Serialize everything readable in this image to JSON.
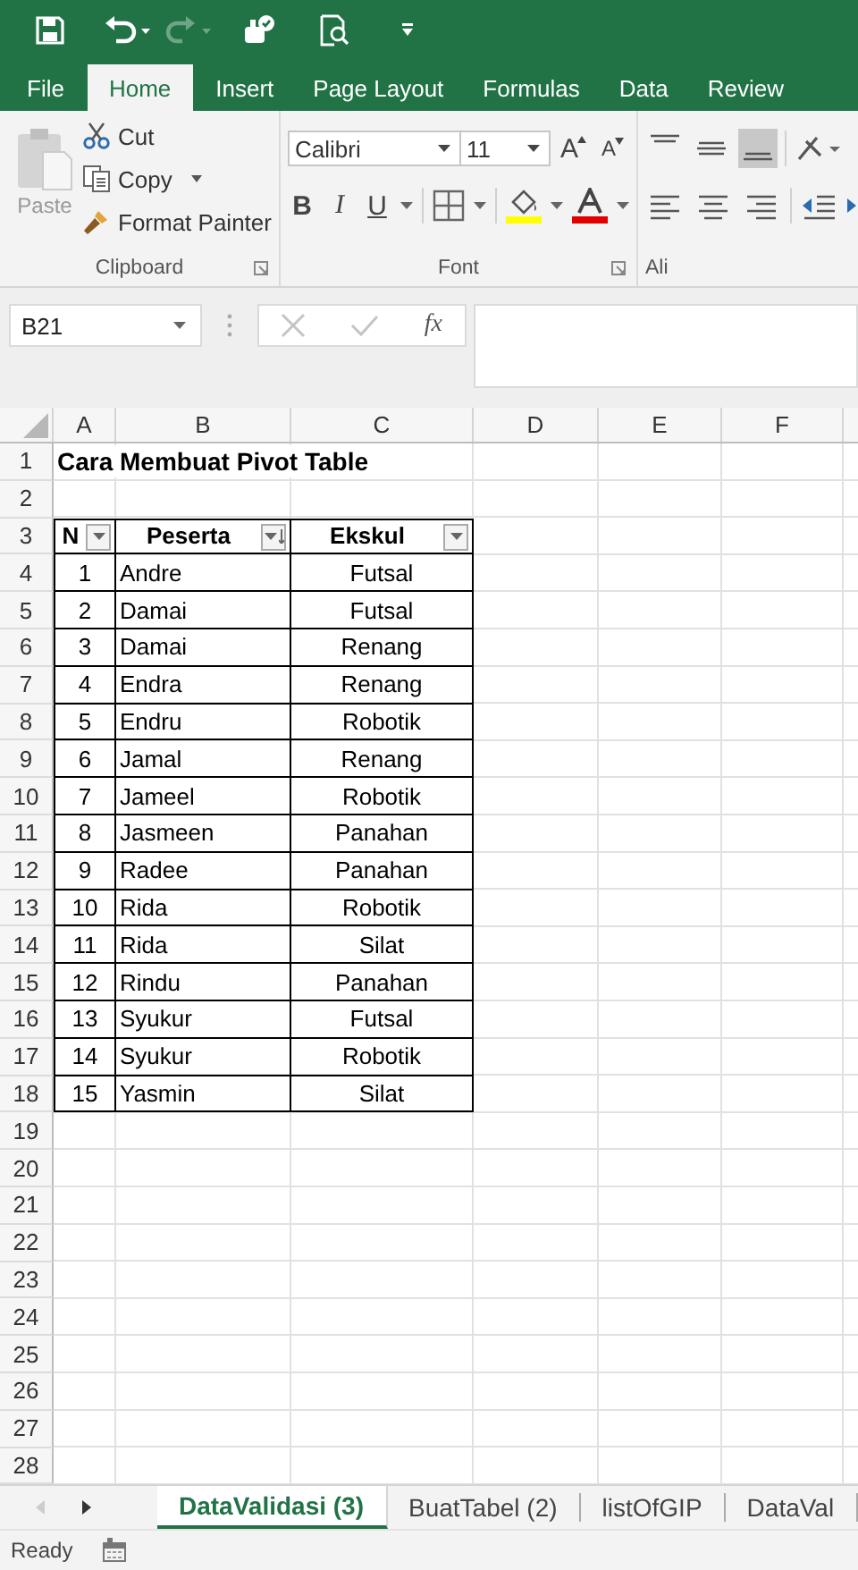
{
  "quick_access": {
    "redo_disabled": true
  },
  "ribbon_tabs": [
    {
      "label": "File",
      "selected": false
    },
    {
      "label": "Home",
      "selected": true
    },
    {
      "label": "Insert",
      "selected": false
    },
    {
      "label": "Page Layout",
      "selected": false
    },
    {
      "label": "Formulas",
      "selected": false
    },
    {
      "label": "Data",
      "selected": false
    },
    {
      "label": "Review",
      "selected": false
    }
  ],
  "clipboard": {
    "paste": "Paste",
    "paste_disabled": true,
    "cut": "Cut",
    "copy": "Copy",
    "format_painter": "Format Painter",
    "group_label": "Clipboard"
  },
  "font": {
    "name": "Calibri",
    "size": "11",
    "grow": "A",
    "shrink": "A",
    "bold": "B",
    "italic": "I",
    "underline": "U",
    "group_label": "Font"
  },
  "alignment": {
    "group_label": "Ali",
    "vertical": [
      {
        "kind": "top",
        "selected": false
      },
      {
        "kind": "middle",
        "selected": false
      },
      {
        "kind": "bottom",
        "selected": true
      }
    ]
  },
  "formula_bar": {
    "name_box": "B21",
    "function_label": "fx"
  },
  "sheet": {
    "columns": [
      "A",
      "B",
      "C",
      "D",
      "E",
      "F"
    ],
    "rows": [
      {
        "number": "1",
        "kind": "title",
        "text": "Cara Membuat Pivot Table"
      },
      {
        "number": "2",
        "kind": "blank"
      },
      {
        "number": "3",
        "kind": "header",
        "cells": [
          {
            "text": "N",
            "sorted": false
          },
          {
            "text": "Peserta",
            "sorted": true
          },
          {
            "text": "Ekskul",
            "sorted": false
          }
        ]
      },
      {
        "number": "4",
        "kind": "data",
        "cells": [
          "1",
          "Andre",
          "Futsal"
        ]
      },
      {
        "number": "5",
        "kind": "data",
        "cells": [
          "2",
          "Damai",
          "Futsal"
        ]
      },
      {
        "number": "6",
        "kind": "data",
        "cells": [
          "3",
          "Damai",
          "Renang"
        ]
      },
      {
        "number": "7",
        "kind": "data",
        "cells": [
          "4",
          "Endra",
          "Renang"
        ]
      },
      {
        "number": "8",
        "kind": "data",
        "cells": [
          "5",
          "Endru",
          "Robotik"
        ]
      },
      {
        "number": "9",
        "kind": "data",
        "cells": [
          "6",
          "Jamal",
          "Renang"
        ]
      },
      {
        "number": "10",
        "kind": "data",
        "cells": [
          "7",
          "Jameel",
          "Robotik"
        ]
      },
      {
        "number": "11",
        "kind": "data",
        "cells": [
          "8",
          "Jasmeen",
          "Panahan"
        ]
      },
      {
        "number": "12",
        "kind": "data",
        "cells": [
          "9",
          "Radee",
          "Panahan"
        ]
      },
      {
        "number": "13",
        "kind": "data",
        "cells": [
          "10",
          "Rida",
          "Robotik"
        ]
      },
      {
        "number": "14",
        "kind": "data",
        "cells": [
          "11",
          "Rida",
          "Silat"
        ]
      },
      {
        "number": "15",
        "kind": "data",
        "cells": [
          "12",
          "Rindu",
          "Panahan"
        ]
      },
      {
        "number": "16",
        "kind": "data",
        "cells": [
          "13",
          "Syukur",
          "Futsal"
        ]
      },
      {
        "number": "17",
        "kind": "data",
        "cells": [
          "14",
          "Syukur",
          "Robotik"
        ]
      },
      {
        "number": "18",
        "kind": "data",
        "cells": [
          "15",
          "Yasmin",
          "Silat"
        ]
      },
      {
        "number": "19",
        "kind": "blank"
      },
      {
        "number": "20",
        "kind": "blank"
      },
      {
        "number": "21",
        "kind": "blank"
      },
      {
        "number": "22",
        "kind": "blank"
      },
      {
        "number": "23",
        "kind": "blank"
      },
      {
        "number": "24",
        "kind": "blank"
      },
      {
        "number": "25",
        "kind": "blank"
      },
      {
        "number": "26",
        "kind": "blank"
      },
      {
        "number": "27",
        "kind": "blank"
      },
      {
        "number": "28",
        "kind": "blank"
      }
    ]
  },
  "sheet_tabs": [
    {
      "label": "DataValidasi (3)",
      "selected": true
    },
    {
      "label": "BuatTabel (2)",
      "selected": false
    },
    {
      "label": "listOfGIP",
      "selected": false
    },
    {
      "label": "DataVal",
      "selected": false
    }
  ],
  "status_bar": {
    "text": "Ready"
  }
}
